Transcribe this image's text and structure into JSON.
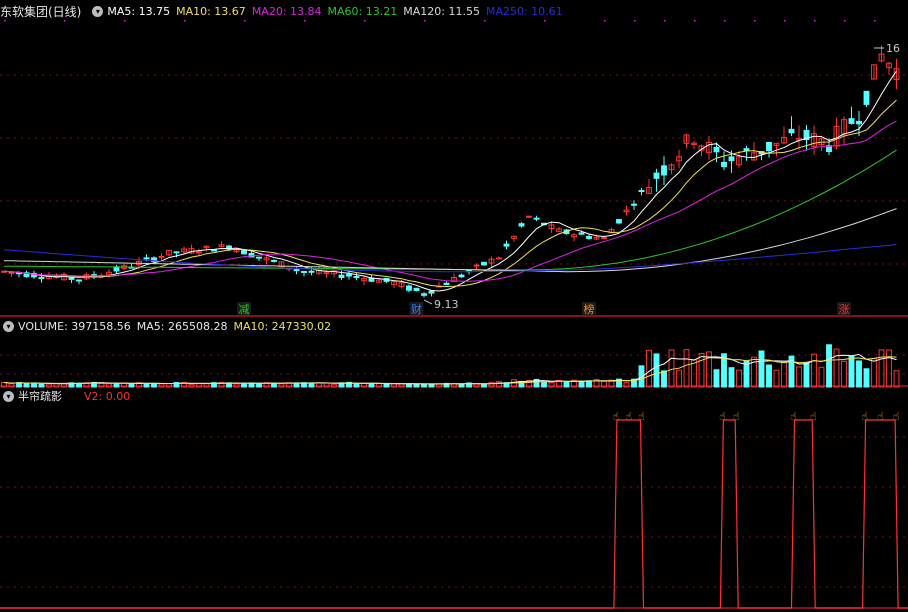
{
  "stock": {
    "name": "东软集团(日线)"
  },
  "price_indicators": [
    {
      "label": "MA5: 13.75",
      "color": "#ffffff"
    },
    {
      "label": "MA10: 13.67",
      "color": "#f0e05a"
    },
    {
      "label": "MA20: 13.84",
      "color": "#e020e0"
    },
    {
      "label": "MA60: 13.21",
      "color": "#28c828"
    },
    {
      "label": "MA120: 11.55",
      "color": "#d8d8d8"
    },
    {
      "label": "MA250: 10.61",
      "color": "#2a2ad8"
    }
  ],
  "volume_pane": {
    "items": [
      {
        "label": "VOLUME: 397158.56",
        "color": "#e6e6e6"
      },
      {
        "label": "MA5: 265508.28",
        "color": "#e6e6e6"
      },
      {
        "label": "MA10: 247330.02",
        "color": "#f0e05a"
      }
    ]
  },
  "indicator_pane": {
    "name": "半帘疏影",
    "value": {
      "label": "V2: 0.00",
      "color": "#ff3030"
    }
  },
  "annotations": {
    "high_label": "16",
    "low_label": "9.13",
    "markers": [
      {
        "text": "减",
        "color": "#28c828"
      },
      {
        "text": "财",
        "color": "#3a7cff"
      },
      {
        "text": "榜",
        "color": "#ff8c1a"
      },
      {
        "text": "涨",
        "color": "#ff3030"
      }
    ]
  },
  "colors": {
    "up": "#ff3232",
    "down": "#54ffff",
    "grid": "#7a1010",
    "separator": "#b01818",
    "signal": "#ff3030",
    "hand_icon": "#ff9a2a"
  },
  "chart_data": {
    "type": "candlestick",
    "price_range": [
      9.13,
      16.0
    ],
    "candles_count": 120,
    "up_down_pattern": "mixed",
    "volume_range": [
      0,
      800000
    ],
    "ma_series": [
      "MA5",
      "MA10",
      "MA20",
      "MA60",
      "MA120",
      "MA250"
    ],
    "signal_pulses": 4,
    "signal_range": [
      0,
      1
    ]
  }
}
